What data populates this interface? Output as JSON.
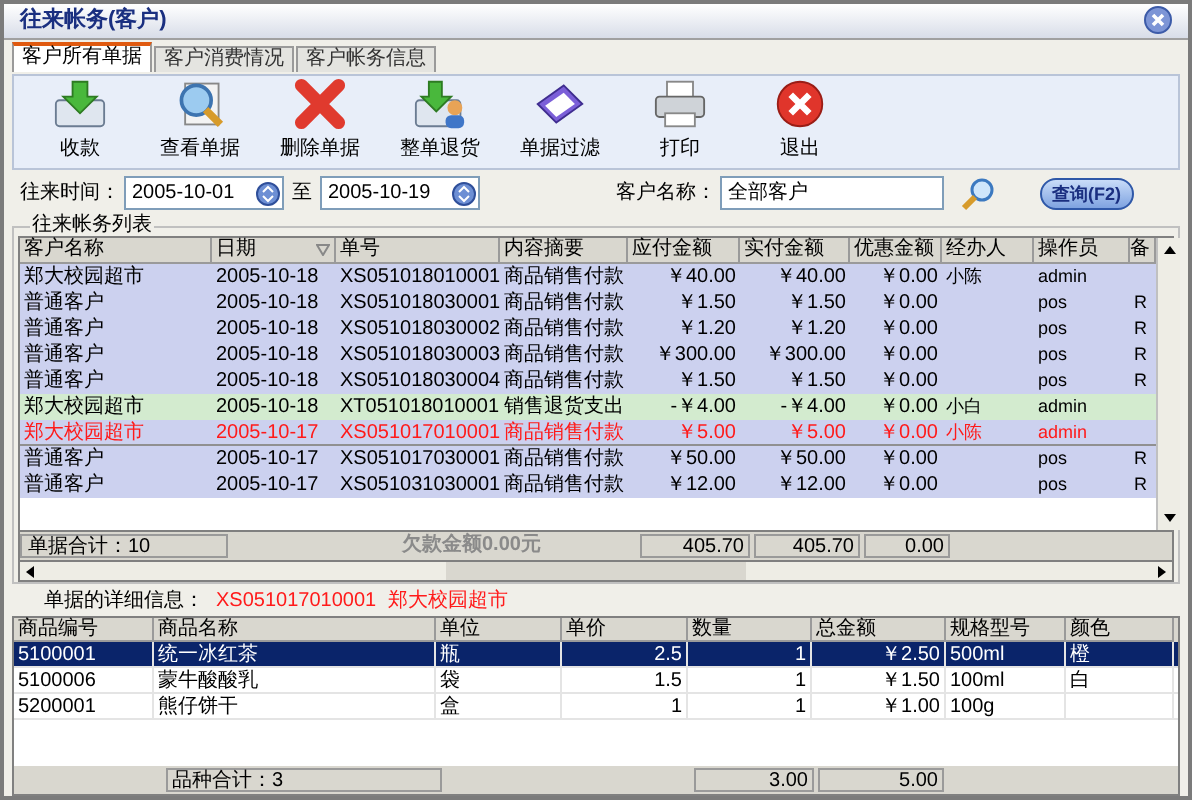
{
  "window": {
    "title": "往来帐务(客户)"
  },
  "tabs": [
    {
      "label": "客户所有单据",
      "selected": true
    },
    {
      "label": "客户消费情况",
      "selected": false
    },
    {
      "label": "客户帐务信息",
      "selected": false
    }
  ],
  "toolbar": [
    {
      "label": "收款",
      "kind": "receive"
    },
    {
      "label": "查看单据",
      "kind": "view"
    },
    {
      "label": "删除单据",
      "kind": "delete"
    },
    {
      "label": "整单退货",
      "kind": "return"
    },
    {
      "label": "单据过滤",
      "kind": "filter"
    },
    {
      "label": "打印",
      "kind": "print"
    },
    {
      "label": "退出",
      "kind": "exit"
    }
  ],
  "filter": {
    "date_label": "往来时间：",
    "date_from": "2005-10-01",
    "to_label": "至",
    "date_to": "2005-10-19",
    "customer_label": "客户名称：",
    "customer": "全部客户",
    "query_button": "查询(F2)"
  },
  "ledger": {
    "title": "往来帐务列表",
    "columns": [
      "客户名称",
      "日期",
      "单号",
      "内容摘要",
      "应付金额",
      "实付金额",
      "优惠金额",
      "经办人",
      "操作员",
      "备"
    ],
    "rows": [
      {
        "kind": "sale",
        "selected": false,
        "customer": "郑大校园超市",
        "date": "2005-10-18",
        "bill_no": "XS051018010001",
        "summary": "商品销售付款",
        "payable": "￥40.00",
        "paid": "￥40.00",
        "discount": "￥0.00",
        "handler": "小陈",
        "operator": "admin"
      },
      {
        "kind": "sale",
        "selected": false,
        "customer": "普通客户",
        "date": "2005-10-18",
        "bill_no": "XS051018030001",
        "summary": "商品销售付款",
        "payable": "￥1.50",
        "paid": "￥1.50",
        "discount": "￥0.00",
        "operator": "pos",
        "remark": "R"
      },
      {
        "kind": "sale",
        "selected": false,
        "customer": "普通客户",
        "date": "2005-10-18",
        "bill_no": "XS051018030002",
        "summary": "商品销售付款",
        "payable": "￥1.20",
        "paid": "￥1.20",
        "discount": "￥0.00",
        "operator": "pos",
        "remark": "R"
      },
      {
        "kind": "sale",
        "selected": false,
        "customer": "普通客户",
        "date": "2005-10-18",
        "bill_no": "XS051018030003",
        "summary": "商品销售付款",
        "payable": "￥300.00",
        "paid": "￥300.00",
        "discount": "￥0.00",
        "operator": "pos",
        "remark": "R"
      },
      {
        "kind": "sale",
        "selected": false,
        "customer": "普通客户",
        "date": "2005-10-18",
        "bill_no": "XS051018030004",
        "summary": "商品销售付款",
        "payable": "￥1.50",
        "paid": "￥1.50",
        "discount": "￥0.00",
        "operator": "pos",
        "remark": "R"
      },
      {
        "kind": "return",
        "selected": false,
        "customer": "郑大校园超市",
        "date": "2005-10-18",
        "bill_no": "XT051018010001",
        "summary": "销售退货支出",
        "payable": "-￥4.00",
        "paid": "-￥4.00",
        "discount": "￥0.00",
        "handler": "小白",
        "operator": "admin"
      },
      {
        "kind": "sale",
        "selected": true,
        "customer": "郑大校园超市",
        "date": "2005-10-17",
        "bill_no": "XS051017010001",
        "summary": "商品销售付款",
        "payable": "￥5.00",
        "paid": "￥5.00",
        "discount": "￥0.00",
        "handler": "小陈",
        "operator": "admin"
      },
      {
        "kind": "sale",
        "selected": false,
        "customer": "普通客户",
        "date": "2005-10-17",
        "bill_no": "XS051017030001",
        "summary": "商品销售付款",
        "payable": "￥50.00",
        "paid": "￥50.00",
        "discount": "￥0.00",
        "operator": "pos",
        "remark": "R"
      },
      {
        "kind": "sale",
        "selected": false,
        "customer": "普通客户",
        "date": "2005-10-17",
        "bill_no": "XS051031030001",
        "summary": "商品销售付款",
        "payable": "￥12.00",
        "paid": "￥12.00",
        "discount": "￥0.00",
        "operator": "pos",
        "remark": "R"
      }
    ],
    "footer": {
      "count": "单据合计：10",
      "debt": "欠款金额0.00元",
      "totals": [
        "405.70",
        "405.70",
        "0.00"
      ]
    }
  },
  "detail": {
    "label": "单据的详细信息：",
    "bill_no": "XS051017010001",
    "customer": "郑大校园超市",
    "columns": [
      "商品编号",
      "商品名称",
      "单位",
      "单价",
      "数量",
      "总金额",
      "规格型号",
      "颜色"
    ],
    "rows": [
      {
        "selected": true,
        "cells": [
          "5100001",
          "统一冰红茶",
          "瓶",
          "2.5",
          "1",
          "￥2.50",
          "500ml",
          "橙"
        ]
      },
      {
        "selected": false,
        "cells": [
          "5100006",
          "蒙牛酸酸乳",
          "袋",
          "1.5",
          "1",
          "￥1.50",
          "100ml",
          "白"
        ]
      },
      {
        "selected": false,
        "cells": [
          "5200001",
          "熊仔饼干",
          "盒",
          "1",
          "1",
          "￥1.00",
          "100g"
        ]
      }
    ],
    "footer": {
      "count": "品种合计：3",
      "totals": [
        "3.00",
        "5.00"
      ]
    }
  }
}
